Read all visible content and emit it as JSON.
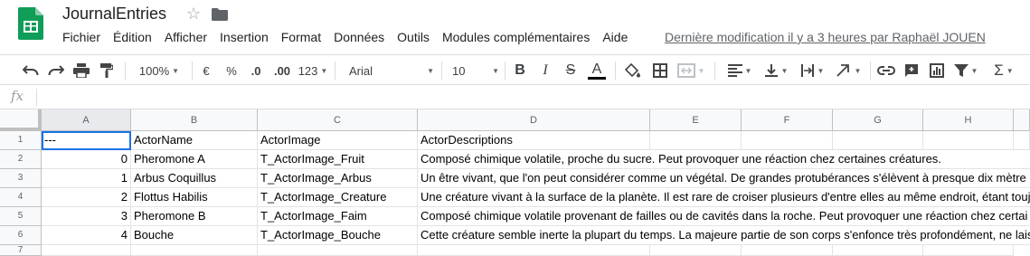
{
  "app": {
    "title": "JournalEntries",
    "last_edit": "Dernière modification il y a 3 heures par Raphaël JOUEN",
    "accent": "#0f9d58"
  },
  "menu": [
    "Fichier",
    "Édition",
    "Afficher",
    "Insertion",
    "Format",
    "Données",
    "Outils",
    "Modules complémentaires",
    "Aide"
  ],
  "toolbar": {
    "zoom": "100%",
    "currency": "€",
    "percent": "%",
    "dec_less": ".0",
    "dec_more": ".00",
    "format_more": "123",
    "font": "Arial",
    "font_size": "10",
    "bold": "B",
    "italic": "I",
    "strike": "S",
    "text_color": "A",
    "functions": "Σ"
  },
  "formula": {
    "fx": "fx",
    "value": ""
  },
  "grid": {
    "columns": [
      "A",
      "B",
      "C",
      "D",
      "E",
      "F",
      "G",
      "H"
    ],
    "rows": [
      [
        "1",
        "---",
        "ActorName",
        "ActorImage",
        "ActorDescriptions"
      ],
      [
        "2",
        "0",
        "Pheromone A",
        "T_ActorImage_Fruit",
        "Composé chimique volatile, proche du sucre. Peut provoquer une réaction chez certaines créatures."
      ],
      [
        "3",
        "1",
        "Arbus Coquillus",
        "T_ActorImage_Arbus",
        "Un être vivant, que l'on peut considérer comme un végétal. De grandes protubérances s'élèvent à presque dix mètre"
      ],
      [
        "4",
        "2",
        "Flottus Habilis",
        "T_ActorImage_Creature",
        "Une créature vivant à la surface de la planète. Il est rare de croiser plusieurs d'entre elles au même endroit, étant touj"
      ],
      [
        "5",
        "3",
        "Pheromone B",
        "T_ActorImage_Faim",
        "Composé chimique volatile provenant de failles ou de cavités dans la roche. Peut provoquer une réaction chez certai"
      ],
      [
        "6",
        "4",
        "Bouche",
        "T_ActorImage_Bouche",
        "Cette créature semble inerte la plupart du temps. La majeure partie de son corps s'enfonce très profondément, ne lais"
      ],
      [
        "7",
        "",
        "",
        "",
        ""
      ]
    ]
  }
}
